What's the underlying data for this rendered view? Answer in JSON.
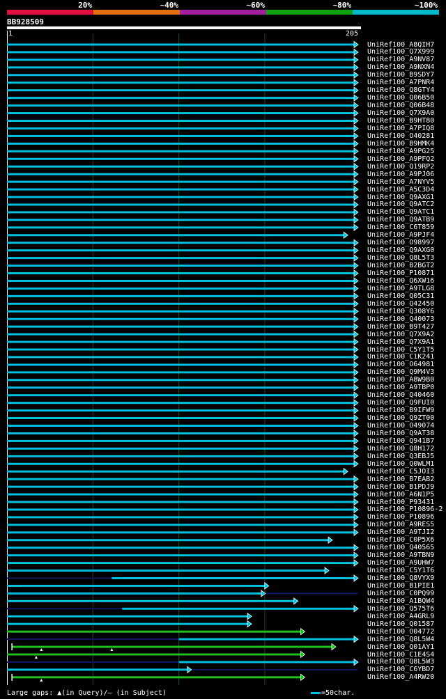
{
  "legend": [
    {
      "label": "20%",
      "color": "#e01040"
    },
    {
      "label": "~40%",
      "color": "#e07010"
    },
    {
      "label": "~60%",
      "color": "#a020a0"
    },
    {
      "label": "~80%",
      "color": "#10a010"
    },
    {
      "label": "~100%",
      "color": "#00b8c8"
    }
  ],
  "query": {
    "name": "BB928509",
    "start_label": "1",
    "end_label": "205",
    "length": 205
  },
  "colors": {
    "full": "#00c0e0",
    "partial": "#20c020",
    "subject_gap": "#0e1a66",
    "grid": "#1e4a1e"
  },
  "hits": [
    {
      "name": "UniRef100_A8QIH7",
      "start": 1,
      "end": 205,
      "type": "full"
    },
    {
      "name": "UniRef100_Q7X999",
      "start": 1,
      "end": 205,
      "type": "full"
    },
    {
      "name": "UniRef100_A9NV87",
      "start": 1,
      "end": 205,
      "type": "full"
    },
    {
      "name": "UniRef100_A9NXN4",
      "start": 1,
      "end": 205,
      "type": "full"
    },
    {
      "name": "UniRef100_B9SDY7",
      "start": 1,
      "end": 205,
      "type": "full"
    },
    {
      "name": "UniRef100_A7PNR4",
      "start": 1,
      "end": 205,
      "type": "full"
    },
    {
      "name": "UniRef100_Q8GTY4",
      "start": 1,
      "end": 205,
      "type": "full"
    },
    {
      "name": "UniRef100_Q06B50",
      "start": 1,
      "end": 205,
      "type": "full"
    },
    {
      "name": "UniRef100_Q06B48",
      "start": 1,
      "end": 205,
      "type": "full"
    },
    {
      "name": "UniRef100_Q7X9A0",
      "start": 1,
      "end": 205,
      "type": "full"
    },
    {
      "name": "UniRef100_B9HT80",
      "start": 1,
      "end": 205,
      "type": "full"
    },
    {
      "name": "UniRef100_A7PIQ8",
      "start": 1,
      "end": 205,
      "type": "full"
    },
    {
      "name": "UniRef100_O40281",
      "start": 1,
      "end": 205,
      "type": "full"
    },
    {
      "name": "UniRef100_B9HMK4",
      "start": 1,
      "end": 205,
      "type": "full"
    },
    {
      "name": "UniRef100_A9PG25",
      "start": 1,
      "end": 205,
      "type": "full"
    },
    {
      "name": "UniRef100_A9PFQ2",
      "start": 1,
      "end": 205,
      "type": "full"
    },
    {
      "name": "UniRef100_Q19RP2",
      "start": 1,
      "end": 205,
      "type": "full"
    },
    {
      "name": "UniRef100_A9PJ06",
      "start": 1,
      "end": 205,
      "type": "full"
    },
    {
      "name": "UniRef100_A7NYV5",
      "start": 1,
      "end": 205,
      "type": "full"
    },
    {
      "name": "UniRef100_A5C3D4",
      "start": 1,
      "end": 205,
      "type": "full"
    },
    {
      "name": "UniRef100_Q9AXG1",
      "start": 1,
      "end": 205,
      "type": "full"
    },
    {
      "name": "UniRef100_Q9ATC2",
      "start": 1,
      "end": 205,
      "type": "full"
    },
    {
      "name": "UniRef100_Q9ATC1",
      "start": 1,
      "end": 205,
      "type": "full"
    },
    {
      "name": "UniRef100_Q9ATB9",
      "start": 1,
      "end": 205,
      "type": "full"
    },
    {
      "name": "UniRef100_C6T859",
      "start": 1,
      "end": 205,
      "type": "full"
    },
    {
      "name": "UniRef100_A9PJF4",
      "start": 1,
      "end": 199,
      "type": "full"
    },
    {
      "name": "UniRef100_O98997",
      "start": 1,
      "end": 205,
      "type": "full"
    },
    {
      "name": "UniRef100_Q9AXG0",
      "start": 1,
      "end": 205,
      "type": "full"
    },
    {
      "name": "UniRef100_Q8L5T3",
      "start": 1,
      "end": 205,
      "type": "full"
    },
    {
      "name": "UniRef100_B2BGT2",
      "start": 1,
      "end": 205,
      "type": "full"
    },
    {
      "name": "UniRef100_P10871",
      "start": 1,
      "end": 205,
      "type": "full"
    },
    {
      "name": "UniRef100_Q6XW16",
      "start": 1,
      "end": 205,
      "type": "full"
    },
    {
      "name": "UniRef100_A9TLG8",
      "start": 1,
      "end": 205,
      "type": "full"
    },
    {
      "name": "UniRef100_Q05C31",
      "start": 1,
      "end": 205,
      "type": "full"
    },
    {
      "name": "UniRef100_Q42450",
      "start": 1,
      "end": 205,
      "type": "full"
    },
    {
      "name": "UniRef100_Q308Y6",
      "start": 1,
      "end": 205,
      "type": "full"
    },
    {
      "name": "UniRef100_Q40073",
      "start": 1,
      "end": 205,
      "type": "full"
    },
    {
      "name": "UniRef100_B9T427",
      "start": 1,
      "end": 205,
      "type": "full"
    },
    {
      "name": "UniRef100_Q7X9A2",
      "start": 1,
      "end": 205,
      "type": "full"
    },
    {
      "name": "UniRef100_Q7X9A1",
      "start": 1,
      "end": 205,
      "type": "full"
    },
    {
      "name": "UniRef100_C5Y1T5",
      "start": 1,
      "end": 205,
      "type": "full"
    },
    {
      "name": "UniRef100_C1K241",
      "start": 1,
      "end": 205,
      "type": "full"
    },
    {
      "name": "UniRef100_O64981",
      "start": 1,
      "end": 205,
      "type": "full"
    },
    {
      "name": "UniRef100_Q9M4V3",
      "start": 1,
      "end": 205,
      "type": "full"
    },
    {
      "name": "UniRef100_A8W9B0",
      "start": 1,
      "end": 205,
      "type": "full"
    },
    {
      "name": "UniRef100_A9TBP0",
      "start": 1,
      "end": 205,
      "type": "full"
    },
    {
      "name": "UniRef100_Q40460",
      "start": 1,
      "end": 205,
      "type": "full"
    },
    {
      "name": "UniRef100_Q9FUI0",
      "start": 1,
      "end": 205,
      "type": "full"
    },
    {
      "name": "UniRef100_B9IFW9",
      "start": 1,
      "end": 205,
      "type": "full"
    },
    {
      "name": "UniRef100_Q9ZT00",
      "start": 1,
      "end": 205,
      "type": "full"
    },
    {
      "name": "UniRef100_O49074",
      "start": 1,
      "end": 205,
      "type": "full"
    },
    {
      "name": "UniRef100_Q9AT38",
      "start": 1,
      "end": 205,
      "type": "full"
    },
    {
      "name": "UniRef100_Q941B7",
      "start": 1,
      "end": 205,
      "type": "full"
    },
    {
      "name": "UniRef100_Q8H172",
      "start": 1,
      "end": 205,
      "type": "full"
    },
    {
      "name": "UniRef100_Q3EBJ5",
      "start": 1,
      "end": 205,
      "type": "full"
    },
    {
      "name": "UniRef100_Q0WLM1",
      "start": 1,
      "end": 205,
      "type": "full"
    },
    {
      "name": "UniRef100_C5JOI3",
      "start": 1,
      "end": 199,
      "type": "full"
    },
    {
      "name": "UniRef100_B7EAB2",
      "start": 1,
      "end": 205,
      "type": "full"
    },
    {
      "name": "UniRef100_B1PDJ9",
      "start": 1,
      "end": 205,
      "type": "full"
    },
    {
      "name": "UniRef100_A6N1P5",
      "start": 1,
      "end": 205,
      "type": "full"
    },
    {
      "name": "UniRef100_P93431",
      "start": 1,
      "end": 205,
      "type": "full"
    },
    {
      "name": "UniRef100_P10896-2",
      "start": 1,
      "end": 205,
      "type": "full"
    },
    {
      "name": "UniRef100_P10896",
      "start": 1,
      "end": 205,
      "type": "full"
    },
    {
      "name": "UniRef100_A9RES5",
      "start": 1,
      "end": 205,
      "type": "full"
    },
    {
      "name": "UniRef100_A9TJI2",
      "start": 1,
      "end": 205,
      "type": "full"
    },
    {
      "name": "UniRef100_C0P5X6",
      "start": 1,
      "end": 190,
      "type": "full"
    },
    {
      "name": "UniRef100_Q40565",
      "start": 1,
      "end": 205,
      "type": "full"
    },
    {
      "name": "UniRef100_A9TBN9",
      "start": 1,
      "end": 205,
      "type": "full"
    },
    {
      "name": "UniRef100_A9UHW7",
      "start": 1,
      "end": 205,
      "type": "full"
    },
    {
      "name": "UniRef100_C5Y1T6",
      "start": 1,
      "end": 188,
      "type": "full"
    },
    {
      "name": "UniRef100_Q8VYX9",
      "start": 62,
      "end": 205,
      "type": "full",
      "gap_before": true
    },
    {
      "name": "UniRef100_B1PIE1",
      "start": 1,
      "end": 153,
      "type": "full"
    },
    {
      "name": "UniRef100_C0PQ99",
      "start": 1,
      "end": 151,
      "type": "full",
      "gap_after": true
    },
    {
      "name": "UniRef100_A1BQW4",
      "start": 1,
      "end": 170,
      "type": "full"
    },
    {
      "name": "UniRef100_Q575T6",
      "start": 68,
      "end": 205,
      "type": "full",
      "gap_before": true
    },
    {
      "name": "UniRef100_A4GRL9",
      "start": 1,
      "end": 143,
      "type": "full"
    },
    {
      "name": "UniRef100_Q01587",
      "start": 1,
      "end": 143,
      "type": "full"
    },
    {
      "name": "UniRef100_O04772",
      "start": 1,
      "end": 174,
      "type": "partial"
    },
    {
      "name": "UniRef100_Q8L5W4",
      "start": 101,
      "end": 205,
      "type": "full",
      "gap_before": true
    },
    {
      "name": "UniRef100_Q01AY1",
      "start": 4,
      "end": 192,
      "type": "partial",
      "query_gaps": [
        21,
        62
      ]
    },
    {
      "name": "UniRef100_C1E4S4",
      "start": 1,
      "end": 174,
      "type": "partial",
      "query_gaps": [
        18
      ]
    },
    {
      "name": "UniRef100_Q8L5W3",
      "start": 101,
      "end": 205,
      "type": "full",
      "gap_before": true
    },
    {
      "name": "UniRef100_C6YBD7",
      "start": 1,
      "end": 108,
      "type": "full",
      "gap_after": true
    },
    {
      "name": "UniRef100_A4RW20",
      "start": 4,
      "end": 174,
      "type": "partial",
      "query_gaps": [
        21
      ]
    }
  ],
  "footer": {
    "gaps_label": "Large gaps:",
    "in_query": "(in Query)/",
    "subject_mark": "—",
    "in_subject": "(in Subject)",
    "scale": "=50char."
  }
}
